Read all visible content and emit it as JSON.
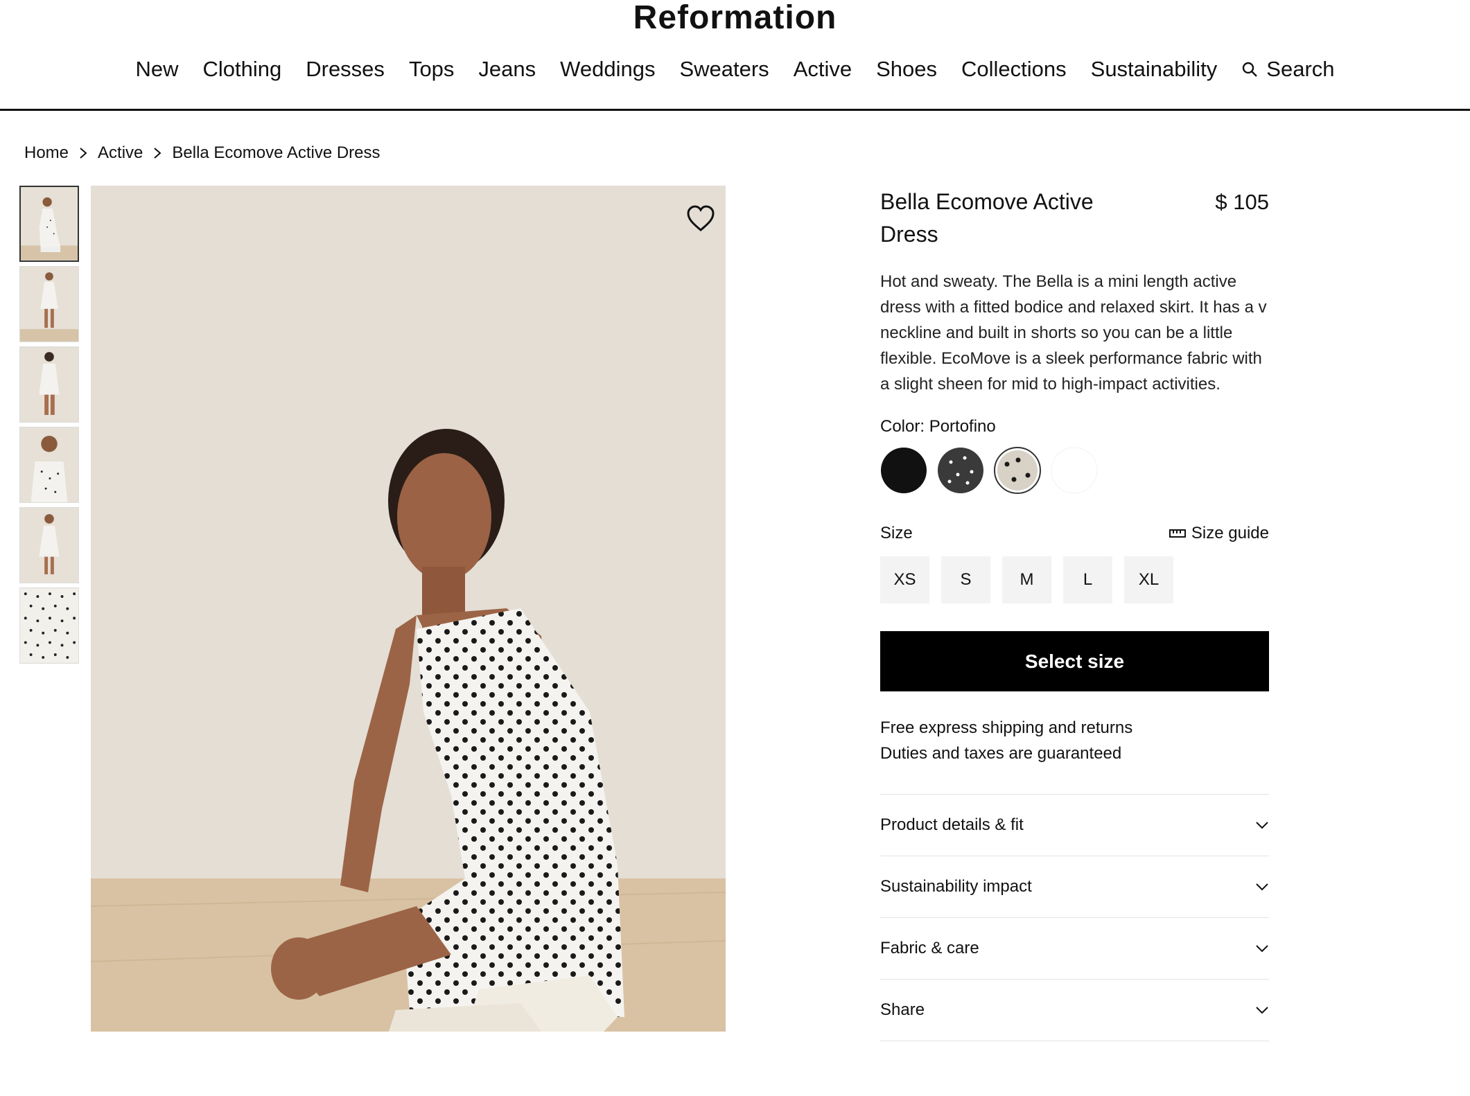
{
  "brand": "Reformation",
  "nav": {
    "items": [
      "New",
      "Clothing",
      "Dresses",
      "Tops",
      "Jeans",
      "Weddings",
      "Sweaters",
      "Active",
      "Shoes",
      "Collections",
      "Sustainability"
    ],
    "search_label": "Search"
  },
  "breadcrumb": [
    "Home",
    "Active",
    "Bella Ecomove Active Dress"
  ],
  "product": {
    "title": "Bella Ecomove Active Dress",
    "price": "$ 105",
    "description": "Hot and sweaty. The Bella is a mini length active dress with a fitted bodice and relaxed skirt. It has a v neckline and built in shorts so you can be a little flexible. EcoMove is a sleek performance fabric with a slight sheen for mid to high-impact activities.",
    "color_label": "Color: Portofino",
    "swatches": [
      {
        "name": "black",
        "color": "#111111"
      },
      {
        "name": "charcoal-dot",
        "color": "#3a3a3a"
      },
      {
        "name": "portofino",
        "color": "#d8d2c6",
        "selected": true
      },
      {
        "name": "white",
        "color": "#ffffff"
      }
    ],
    "size_label": "Size",
    "size_guide_label": "Size guide",
    "sizes": [
      "XS",
      "S",
      "M",
      "L",
      "XL"
    ],
    "cta_label": "Select size",
    "shipping_lines": [
      "Free express shipping and returns",
      "Duties and taxes are guaranteed"
    ],
    "accordion": [
      "Product details & fit",
      "Sustainability impact",
      "Fabric & care",
      "Share"
    ]
  },
  "thumbnails": [
    "front-crouch",
    "front-standing",
    "back-standing",
    "front-closeup",
    "front-standing-2",
    "fabric-swatch"
  ]
}
